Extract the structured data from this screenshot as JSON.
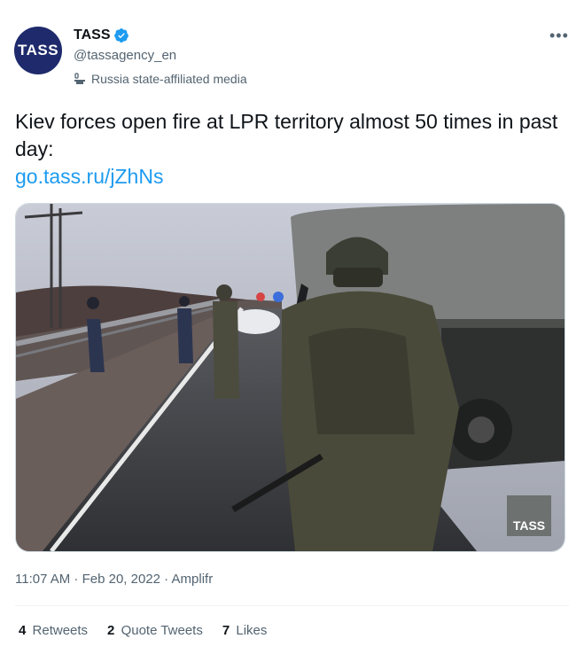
{
  "account": {
    "avatar_text": "TASS",
    "name": "TASS",
    "handle": "@tassagency_en",
    "label": "Russia state-affiliated media"
  },
  "tweet": {
    "text": "Kiev forces open fire at LPR territory almost 50 times in past day:",
    "link": "go.tass.ru/jZhNs",
    "media_watermark": "TASS"
  },
  "meta": {
    "time": "11:07 AM",
    "separator": " · ",
    "date": "Feb 20, 2022",
    "source": "Amplifr"
  },
  "stats": {
    "retweets_count": "4",
    "retweets_label": "Retweets",
    "quotes_count": "2",
    "quotes_label": "Quote Tweets",
    "likes_count": "7",
    "likes_label": "Likes"
  },
  "icons": {
    "verified": "verified-badge-icon",
    "state_media": "podium-icon",
    "more": "more-dots-icon"
  },
  "colors": {
    "link": "#1d9bf0",
    "verified": "#1d9bf0",
    "avatar_bg": "#1e2a6b",
    "secondary_text": "#536471"
  }
}
